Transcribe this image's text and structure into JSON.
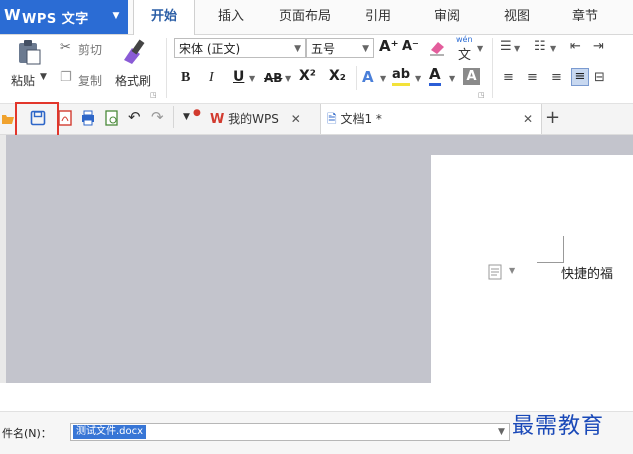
{
  "app": {
    "name": "WPS 文字"
  },
  "tabs": [
    {
      "label": "开始",
      "active": true
    },
    {
      "label": "插入"
    },
    {
      "label": "页面布局"
    },
    {
      "label": "引用"
    },
    {
      "label": "审阅"
    },
    {
      "label": "视图"
    },
    {
      "label": "章节"
    }
  ],
  "ribbon": {
    "paste_label": "粘贴",
    "cut_label": "剪切",
    "copy_label": "复制",
    "format_painter_label": "格式刷",
    "font_name": "宋体 (正文)",
    "font_size": "五号",
    "bold": "B",
    "italic": "I",
    "underline": "U",
    "strike": "AB",
    "superscript": "X²",
    "subscript": "X₂",
    "font_color_glyph": "A",
    "highlight_glyph": "ab",
    "grow_font": "A⁺",
    "shrink_font": "A⁻",
    "pinyin": "wén"
  },
  "doc_tabs": [
    {
      "label": "我的WPS"
    },
    {
      "label": "文档1 *"
    }
  ],
  "document": {
    "text": "快捷的福"
  },
  "save_dialog": {
    "filename_label": "件名(N)：",
    "filename_value": "测试文件.docx"
  },
  "watermark": "最需教育",
  "colors": {
    "brand": "#2b6cd4",
    "highlight_box": "#e2362b",
    "doc_bg": "#c3c4cc"
  }
}
